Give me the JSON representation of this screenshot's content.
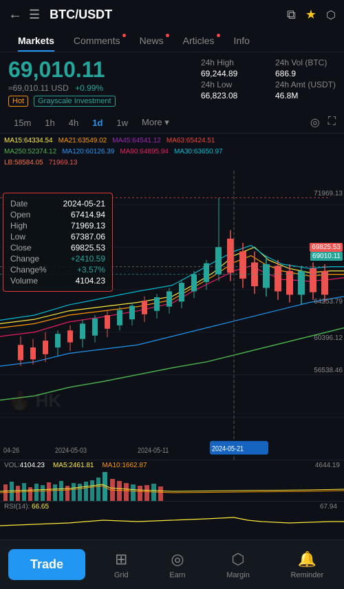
{
  "header": {
    "back_icon": "←",
    "menu_icon": "☰",
    "title": "BTC/USDT",
    "copy_icon": "⧉",
    "star_icon": "★",
    "share_icon": "⤴"
  },
  "nav_tabs": [
    {
      "label": "Markets",
      "active": true,
      "dot": false
    },
    {
      "label": "Comments",
      "active": false,
      "dot": true
    },
    {
      "label": "News",
      "active": false,
      "dot": true
    },
    {
      "label": "Articles",
      "active": false,
      "dot": true
    },
    {
      "label": "Info",
      "active": false,
      "dot": false
    }
  ],
  "price": {
    "main": "69,010.11",
    "usd": "≈69,010.11 USD",
    "change": "+0.99%",
    "high_24h_label": "24h High",
    "high_24h": "69,244.89",
    "vol_btc_label": "24h Vol (BTC)",
    "vol_btc": "686.9",
    "low_24h_label": "24h Low",
    "low_24h": "66,823.08",
    "amt_usdt_label": "24h Amt (USDT)",
    "amt_usdt": "46.8M"
  },
  "tags": {
    "hot": "Hot",
    "grayscale": "Grayscale Investment"
  },
  "timeframes": [
    "15m",
    "1h",
    "4h",
    "1d",
    "1w",
    "More ▾"
  ],
  "active_tf": "1d",
  "ma_indicators": [
    {
      "label": "MA15:",
      "value": "64334.54",
      "color": "#ffeb3b"
    },
    {
      "label": "MA21:",
      "value": "63549.02",
      "color": "#ff9800"
    },
    {
      "label": "MA45:",
      "value": "64541.12",
      "color": "#9c27b0"
    },
    {
      "label": "MA63:",
      "value": "65424.51",
      "color": "#f44336"
    },
    {
      "label": "MA250:",
      "value": "52374.12",
      "color": "#4caf50"
    },
    {
      "label": "MA120:",
      "value": "60126.39",
      "color": "#2196f3"
    },
    {
      "label": "MA90:",
      "value": "64895.94",
      "color": "#e91e63"
    },
    {
      "label": "MA30:",
      "value": "63650.97",
      "color": "#00bcd4"
    }
  ],
  "lb_label": "LB:58584.05",
  "lb_value": "71969.13",
  "ohlc": {
    "date_label": "Date",
    "date_value": "2024-05-21",
    "open_label": "Open",
    "open_value": "67414.94",
    "high_label": "High",
    "high_value": "71969.13",
    "low_label": "Low",
    "low_value": "67387.06",
    "close_label": "Close",
    "close_value": "69825.53",
    "change_label": "Change",
    "change_value": "+2410.59",
    "changepct_label": "Change%",
    "changepct_value": "+3.57%",
    "volume_label": "Volume",
    "volume_value": "4104.23"
  },
  "y_labels": [
    "71969.13",
    "69825.53",
    "69010.11",
    "64253.79",
    "60396.12",
    "56538.46"
  ],
  "x_labels": [
    "04-26",
    "2024-05-03",
    "2024-05-11",
    "2024-05-21"
  ],
  "date_selected": "2024-05-21",
  "volume": {
    "vol_label": "VOL:",
    "vol_value": "4104.23",
    "ma5_label": "MA5:",
    "ma5_value": "2461.81",
    "ma10_label": "MA10:",
    "ma10_value": "1662.87",
    "right_value": "4644.19"
  },
  "rsi": {
    "label": "RSI(14):",
    "value": "66.65",
    "right": "67.94"
  },
  "bottom_nav": {
    "trade_label": "Trade",
    "grid_label": "Grid",
    "earn_label": "Earn",
    "margin_label": "Margin",
    "reminder_label": "Reminder"
  },
  "watermark": "🔥 HK"
}
